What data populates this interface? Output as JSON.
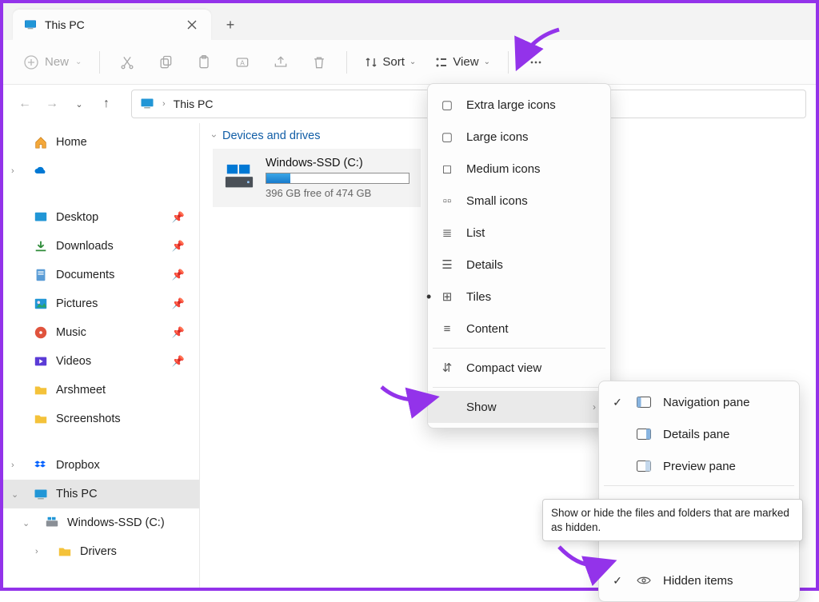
{
  "tab": {
    "title": "This PC"
  },
  "toolbar": {
    "new_label": "New",
    "sort_label": "Sort",
    "view_label": "View"
  },
  "breadcrumb": {
    "location": "This PC"
  },
  "sidebar": {
    "home": "Home",
    "onedrive": "",
    "pinned": [
      {
        "label": "Desktop"
      },
      {
        "label": "Downloads"
      },
      {
        "label": "Documents"
      },
      {
        "label": "Pictures"
      },
      {
        "label": "Music"
      },
      {
        "label": "Videos"
      },
      {
        "label": "Arshmeet"
      },
      {
        "label": "Screenshots"
      }
    ],
    "dropbox": "Dropbox",
    "thispc": "This PC",
    "drive": "Windows-SSD (C:)",
    "drivers": "Drivers"
  },
  "content": {
    "section": "Devices and drives",
    "drive_name": "Windows-SSD (C:)",
    "drive_free": "396 GB free of 474 GB"
  },
  "view_menu": {
    "items": [
      {
        "label": "Extra large icons"
      },
      {
        "label": "Large icons"
      },
      {
        "label": "Medium icons"
      },
      {
        "label": "Small icons"
      },
      {
        "label": "List"
      },
      {
        "label": "Details"
      },
      {
        "label": "Tiles",
        "selected": true
      },
      {
        "label": "Content"
      }
    ],
    "compact": "Compact view",
    "show": "Show"
  },
  "show_menu": {
    "nav": "Navigation pane",
    "details": "Details pane",
    "preview": "Preview pane",
    "hidden": "Hidden items"
  },
  "tooltip": "Show or hide the files and folders that are marked as hidden."
}
